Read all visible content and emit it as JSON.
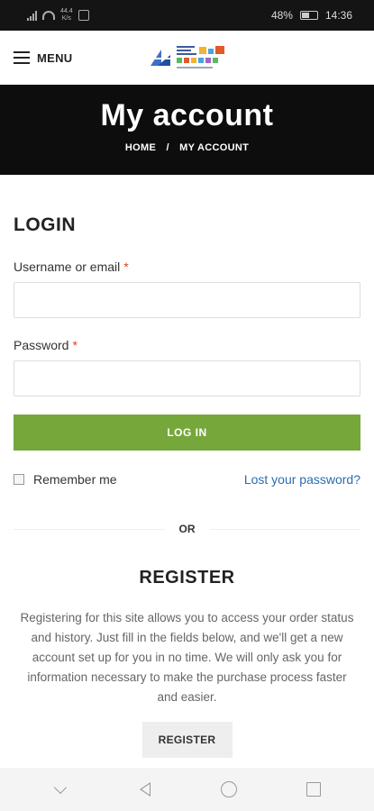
{
  "status_bar": {
    "speed": "44.4",
    "speed_unit": "K/s",
    "battery": "48%",
    "time": "14:36"
  },
  "header": {
    "menu_label": "MENU",
    "logo_icon": "company-logo"
  },
  "hero": {
    "title": "My account",
    "breadcrumb": [
      "HOME",
      "MY ACCOUNT"
    ],
    "separator": "/"
  },
  "login": {
    "title": "LOGIN",
    "username_label": "Username or email",
    "username_value": "",
    "password_label": "Password",
    "password_value": "",
    "required_mark": "*",
    "button_label": "LOG IN",
    "remember_label": "Remember me",
    "lost_password_label": "Lost your password?"
  },
  "divider": {
    "label": "OR"
  },
  "register": {
    "title": "REGISTER",
    "description": "Registering for this site allows you to access your order status and history. Just fill in the fields below, and we'll get a new account set up for you in no time. We will only ask you for information necessary to make the purchase process faster and easier.",
    "button_label": "REGISTER"
  },
  "colors": {
    "accent_green": "#76a73b",
    "link_blue": "#2a6cb0",
    "required_red": "#e2401c",
    "hero_bg": "#0d0d0d"
  },
  "nav_bar": {
    "icons": [
      "chevron-down-icon",
      "back-icon",
      "home-icon",
      "recents-icon"
    ]
  }
}
